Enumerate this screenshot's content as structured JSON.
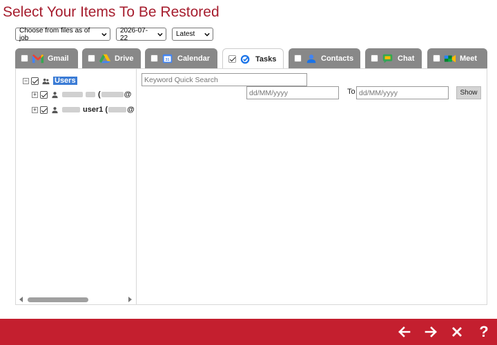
{
  "page": {
    "title": "Select Your Items To Be Restored"
  },
  "selectors": {
    "job": "Choose from files as of job",
    "date": "2026-07-22",
    "version": "Latest"
  },
  "tabs": [
    {
      "label": "Gmail",
      "checked": false,
      "active": false,
      "icon": "gmail-icon"
    },
    {
      "label": "Drive",
      "checked": false,
      "active": false,
      "icon": "drive-icon"
    },
    {
      "label": "Calendar",
      "checked": false,
      "active": false,
      "icon": "calendar-icon"
    },
    {
      "label": "Tasks",
      "checked": true,
      "active": true,
      "icon": "tasks-icon"
    },
    {
      "label": "Contacts",
      "checked": false,
      "active": false,
      "icon": "contacts-icon"
    },
    {
      "label": "Chat",
      "checked": false,
      "active": false,
      "icon": "chat-icon"
    },
    {
      "label": "Meet",
      "checked": false,
      "active": false,
      "icon": "meet-icon"
    }
  ],
  "tree": {
    "root_label": "Users",
    "children": [
      {
        "label_prefix": "",
        "label_suffix": "(",
        "at": "@"
      },
      {
        "label_prefix": "user1",
        "label_suffix": "(",
        "at": "@"
      }
    ]
  },
  "filters": {
    "search_placeholder": "Keyword Quick Search",
    "date_from_placeholder": "dd/MM/yyyy",
    "to_label": "To",
    "date_to_placeholder": "dd/MM/yyyy",
    "show_label": "Show"
  },
  "footer": {
    "help_label": "?"
  },
  "colors": {
    "brand": "#c41f2f",
    "title": "#a61d2e",
    "tab_inactive": "#888888",
    "selection": "#3a7bd5"
  }
}
